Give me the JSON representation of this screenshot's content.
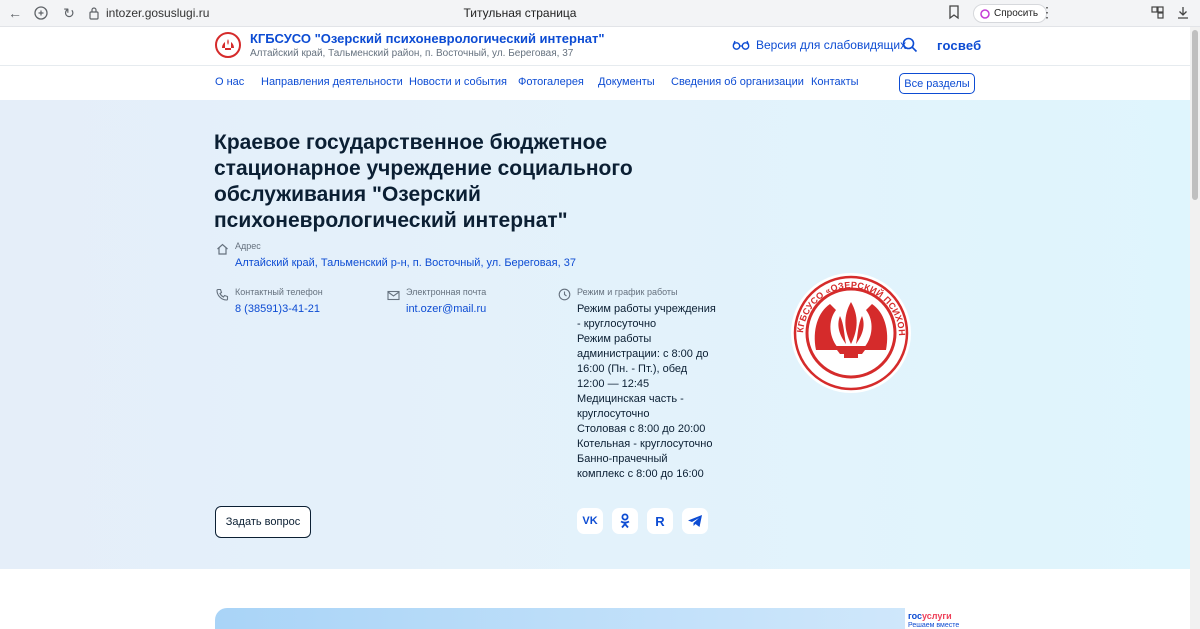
{
  "browser": {
    "url": "intozer.gosuslugi.ru",
    "tab_title": "Титульная страница",
    "ask_label": "Спросить"
  },
  "header": {
    "org_name": "КГБСУСО \"Озерский психоневрологический интернат\"",
    "org_address": "Алтайский край, Тальменский район, п. Восточный, ул. Береговая, 37",
    "low_vision_label": "Версия для слабовидящих",
    "gosweb_label": "госвеб"
  },
  "nav": {
    "items": [
      "О нас",
      "Направления деятельности",
      "Новости и события",
      "Фотогалерея",
      "Документы",
      "Сведения об организации",
      "Контакты"
    ],
    "all_sections": "Все разделы"
  },
  "hero": {
    "title": "Краевое государственное бюджетное стационарное учреждение социального обслуживания \"Озерский психоневрологический интернат\"",
    "address_label": "Адрес",
    "address_value": "Алтайский край, Тальменский р-н, п. Восточный, ул. Береговая, 37",
    "phone_label": "Контактный телефон",
    "phone_value": "8 (38591)3-41-21",
    "email_label": "Электронная почта",
    "email_value": "int.ozer@mail.ru",
    "hours_label": "Режим и график работы",
    "hours_lines": [
      "Режим работы учреждения - круглосуточно",
      "Режим работы администрации: с 8:00 до 16:00 (Пн. - Пт.), обед 12:00 — 12:45",
      "Медицинская часть - круглосуточно",
      "Столовая с 8:00 до 20:00",
      "Котельная - круглосуточно",
      "Банно-прачечный комплекс с 8:00 до 16:00"
    ],
    "emblem_text": "КГБСУСО «ОЗЕРСКИЙ ПСИХОНЕВРОЛОГИЧЕСКИЙ ИНТЕРНАТ»",
    "ask_question_label": "Задать вопрос"
  },
  "social": {
    "vk": "VK",
    "ok": "OK",
    "rutube": "R",
    "telegram": "telegram"
  },
  "gosuslugi": {
    "logo_part1": "гос",
    "logo_part2": "услуги",
    "tagline": "Решаем вместе"
  },
  "colors": {
    "accent": "#0d4cd3",
    "emblem_red": "#d52b2b",
    "text_dark": "#0b1f33",
    "text_muted": "#66727f"
  }
}
